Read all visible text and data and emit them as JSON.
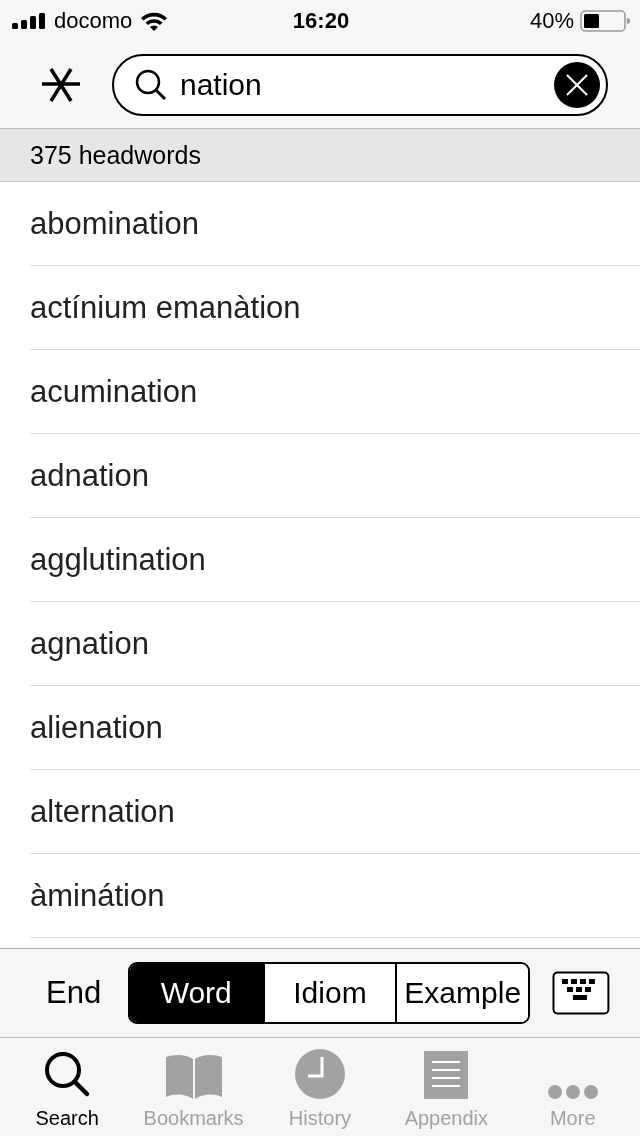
{
  "status_bar": {
    "carrier": "docomo",
    "time": "16:20",
    "battery": "40%"
  },
  "search": {
    "value": "nation"
  },
  "result_count": "375 headwords",
  "results": [
    "abomination",
    "actínium emanàtion",
    "acumination",
    "adnation",
    "agglutination",
    "agnation",
    "alienation",
    "alternation",
    "àminátion"
  ],
  "toolbar": {
    "end_label": "End",
    "segments": [
      {
        "label": "Word",
        "selected": true
      },
      {
        "label": "Idiom",
        "selected": false
      },
      {
        "label": "Example",
        "selected": false
      }
    ]
  },
  "tab_bar": [
    {
      "label": "Search",
      "kind": "search",
      "selected": true
    },
    {
      "label": "Bookmarks",
      "kind": "bookmarks",
      "selected": false
    },
    {
      "label": "History",
      "kind": "history",
      "selected": false
    },
    {
      "label": "Appendix",
      "kind": "appendix",
      "selected": false
    },
    {
      "label": "More",
      "kind": "more",
      "selected": false
    }
  ]
}
